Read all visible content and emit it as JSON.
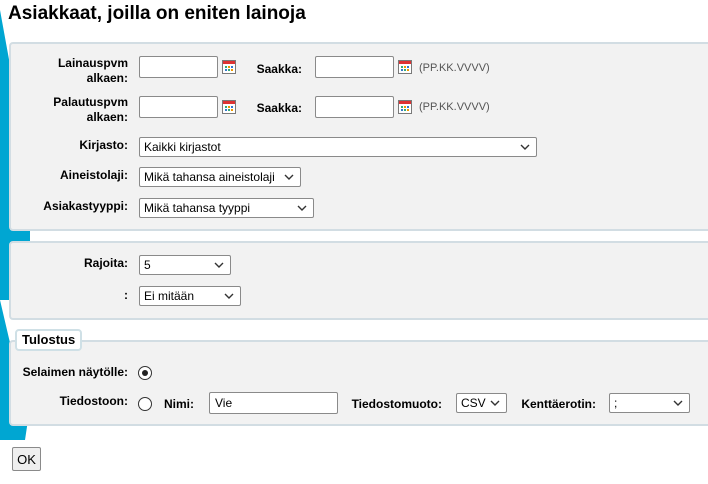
{
  "page": {
    "title": "Asiakkaat, joilla on eniten lainoja"
  },
  "dates": {
    "loan_label": "Lainauspvm alkaen:",
    "loan_to_label": "Saakka:",
    "return_label": "Palautuspvm alkaen:",
    "return_to_label": "Saakka:",
    "loan_from_value": "",
    "loan_to_value": "",
    "return_from_value": "",
    "return_to_value": "",
    "format_hint": "(PP.KK.VVVV)",
    "format_hint_2": "(PP.KK.VVVV)"
  },
  "filters": {
    "library_label": "Kirjasto:",
    "library_value": "Kaikki kirjastot",
    "material_label": "Aineistolaji:",
    "material_value": "Mikä tahansa aineistolaji",
    "customer_type_label": "Asiakastyyppi:",
    "customer_type_value": "Mikä tahansa tyyppi"
  },
  "limit": {
    "limit_label": "Rajoita:",
    "limit_value": "5",
    "second_label": ":",
    "second_value": "Ei mitään"
  },
  "output": {
    "legend": "Tulostus",
    "browser_label": "Selaimen näytölle:",
    "browser_selected": true,
    "file_label": "Tiedostoon:",
    "file_selected": false,
    "name_label": "Nimi:",
    "name_value": "Vie",
    "format_label": "Tiedostomuoto:",
    "format_value": "CSV",
    "separator_label": "Kenttäerotin:",
    "separator_value": ";"
  },
  "buttons": {
    "ok_label": "OK"
  },
  "colors": {
    "accent": "#00a0c8",
    "panel_bg": "#f2f2f2",
    "panel_border": "#d2dde3"
  }
}
